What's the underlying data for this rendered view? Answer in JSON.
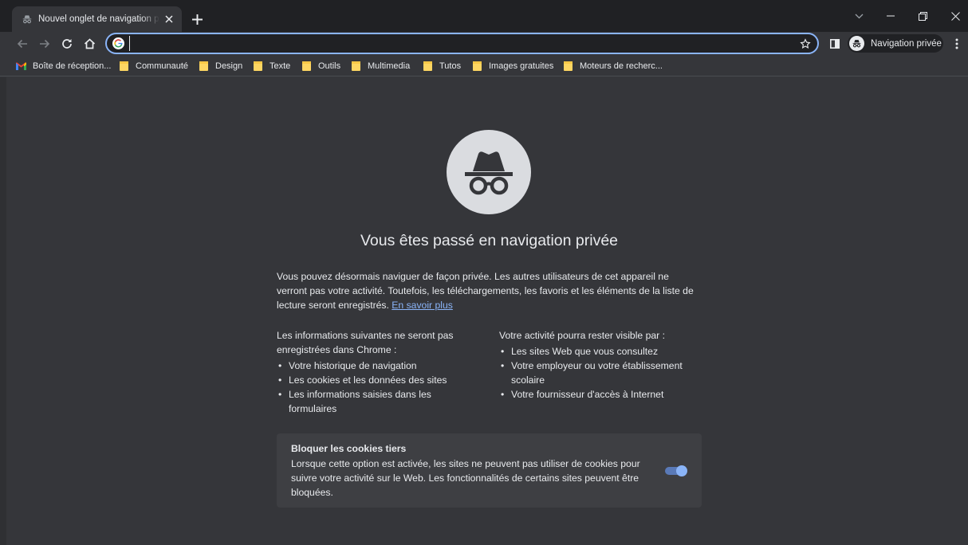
{
  "tab": {
    "title": "Nouvel onglet de navigation privée",
    "favicon": "incognito-icon"
  },
  "toolbar": {
    "address_value": "",
    "profile_label": "Navigation privée"
  },
  "bookmarks": [
    {
      "label": "Boîte de réception...",
      "icon": "gmail-icon"
    },
    {
      "label": "Communauté",
      "icon": "folder-icon"
    },
    {
      "label": "Design",
      "icon": "folder-icon"
    },
    {
      "label": "Texte",
      "icon": "folder-icon"
    },
    {
      "label": "Outils",
      "icon": "folder-icon"
    },
    {
      "label": "Multimedia",
      "icon": "folder-icon"
    },
    {
      "label": "Tutos",
      "icon": "folder-icon"
    },
    {
      "label": "Images gratuites",
      "icon": "folder-icon"
    },
    {
      "label": "Moteurs de recherc..."
    }
  ],
  "page": {
    "heading": "Vous êtes passé en navigation privée",
    "intro": "Vous pouvez désormais naviguer de façon privée. Les autres utilisateurs de cet appareil ne verront pas votre activité. Toutefois, les téléchargements, les favoris et les éléments de la liste de lecture seront enregistrés.",
    "learn_more": "En savoir plus",
    "not_saved": {
      "title": "Les informations suivantes ne seront pas enregistrées dans Chrome :",
      "items": [
        "Votre historique de navigation",
        "Les cookies et les données des sites",
        "Les informations saisies dans les formulaires"
      ]
    },
    "visible_to": {
      "title": "Votre activité pourra rester visible par :",
      "items": [
        "Les sites Web que vous consultez",
        "Votre employeur ou votre établissement scolaire",
        "Votre fournisseur d'accès à Internet"
      ]
    },
    "cookies": {
      "title": "Bloquer les cookies tiers",
      "description": "Lorsque cette option est activée, les sites ne peuvent pas utiliser de cookies pour suivre votre activité sur le Web. Les fonctionnalités de certains sites peuvent être bloquées.",
      "enabled": true
    }
  },
  "colors": {
    "frame": "#202124",
    "toolbar": "#35363a",
    "accent": "#8ab4f8",
    "text": "#e8eaed",
    "card": "#3e3f43"
  }
}
